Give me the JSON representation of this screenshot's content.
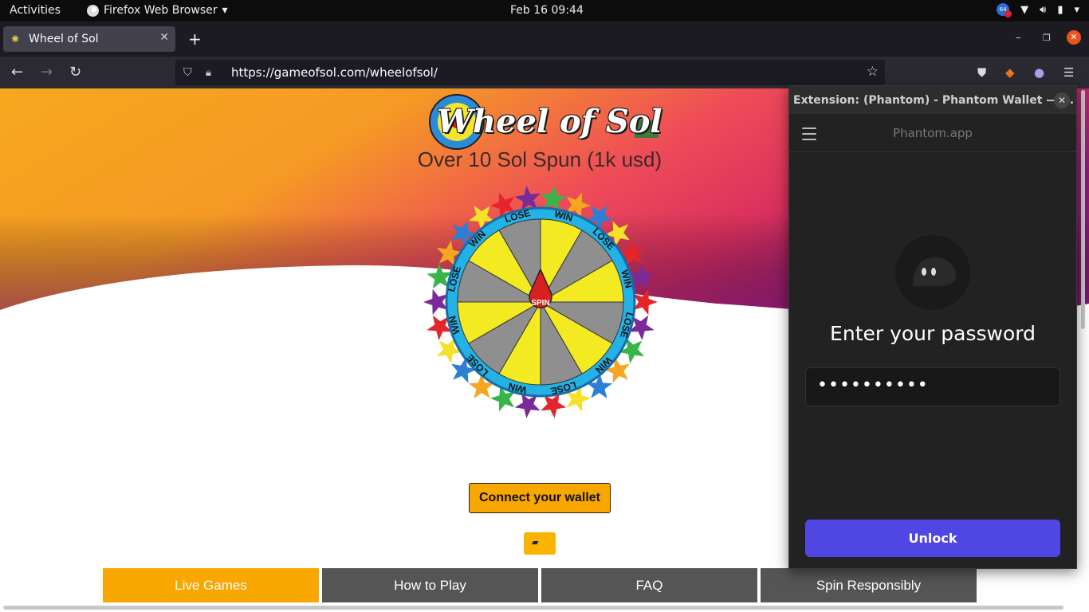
{
  "system": {
    "activities": "Activities",
    "app_menu": "Firefox Web Browser",
    "datetime": "Feb 16  09:44",
    "notification_count": "64"
  },
  "browser": {
    "tab_title": "Wheel of Sol",
    "url": "https://gameofsol.com/wheelofsol/"
  },
  "page": {
    "logo_text": "Wheel of Sol",
    "subtitle": "Over 10 Sol Spun (1k usd)",
    "wheel_center": "SPIN",
    "wheel_labels": [
      "WIN",
      "LOSE",
      "WIN",
      "LOSE",
      "WIN",
      "LOSE",
      "WIN",
      "LOSE",
      "WIN",
      "LOSE",
      "WIN",
      "LOSE"
    ],
    "connect_button": "Connect your wallet",
    "nav_tabs": [
      {
        "label": "Live Games",
        "color": "#f8a600"
      },
      {
        "label": "How to Play",
        "color": "#555555"
      },
      {
        "label": "FAQ",
        "color": "#555555"
      },
      {
        "label": "Spin Responsibly",
        "color": "#555555"
      }
    ]
  },
  "phantom": {
    "window_title": "Extension: (Phantom) - Phantom Wallet — ...",
    "site": "Phantom.app",
    "heading": "Enter your password",
    "password_value": "••••••••••",
    "unlock_label": "Unlock",
    "accent_color": "#5046e4"
  }
}
